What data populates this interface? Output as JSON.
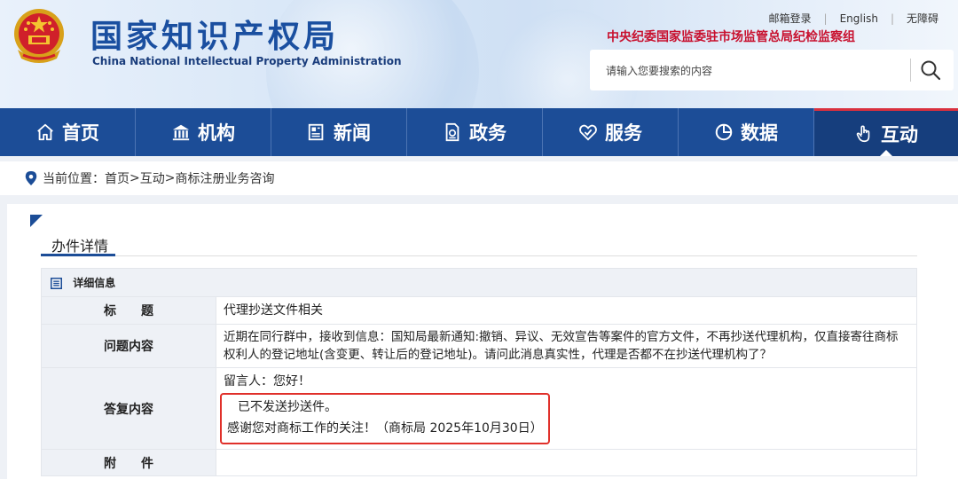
{
  "header": {
    "title_cn": "国家知识产权局",
    "title_en": "China National Intellectual Property Administration",
    "top_links": [
      "邮箱登录",
      "English",
      "无障碍"
    ],
    "supervision": "中央纪委国家监委驻市场监管总局纪检监察组",
    "search": {
      "placeholder": "请输入您要搜索的内容"
    }
  },
  "nav": {
    "items": [
      {
        "label": "首页",
        "icon": "home-icon"
      },
      {
        "label": "机构",
        "icon": "institution-icon"
      },
      {
        "label": "新闻",
        "icon": "news-icon"
      },
      {
        "label": "政务",
        "icon": "government-icon"
      },
      {
        "label": "服务",
        "icon": "service-icon"
      },
      {
        "label": "数据",
        "icon": "data-icon"
      },
      {
        "label": "互动",
        "icon": "interaction-icon"
      }
    ],
    "active": "互动"
  },
  "breadcrumb": {
    "prefix": "当前位置：",
    "items": [
      "首页",
      "互动",
      "商标注册业务咨询"
    ],
    "separator": ">"
  },
  "section": {
    "title": "办件详情",
    "table_header": "详细信息",
    "rows": {
      "title_label": "标　　题",
      "title_value": "代理抄送文件相关",
      "question_label": "问题内容",
      "question_value": "近期在同行群中，接收到信息：国知局最新通知:撤销、异议、无效宣告等案件的官方文件，不再抄送代理机构，仅直接寄往商标权利人的登记地址(含变更、转让后的登记地址)。请问此消息真实性，代理是否都不在抄送代理机构了？",
      "reply_label": "答复内容",
      "reply_greeting": "留言人：您好！",
      "reply_line1": "已不发送抄送件。",
      "reply_line2": "感谢您对商标工作的关注！（商标局 2025年10月30日）",
      "attachment_label": "附　　件",
      "attachment_value": ""
    }
  },
  "colors": {
    "nav_bg": "#1c4d97",
    "accent_red": "#c8102e",
    "highlight_border": "#e0302a"
  }
}
